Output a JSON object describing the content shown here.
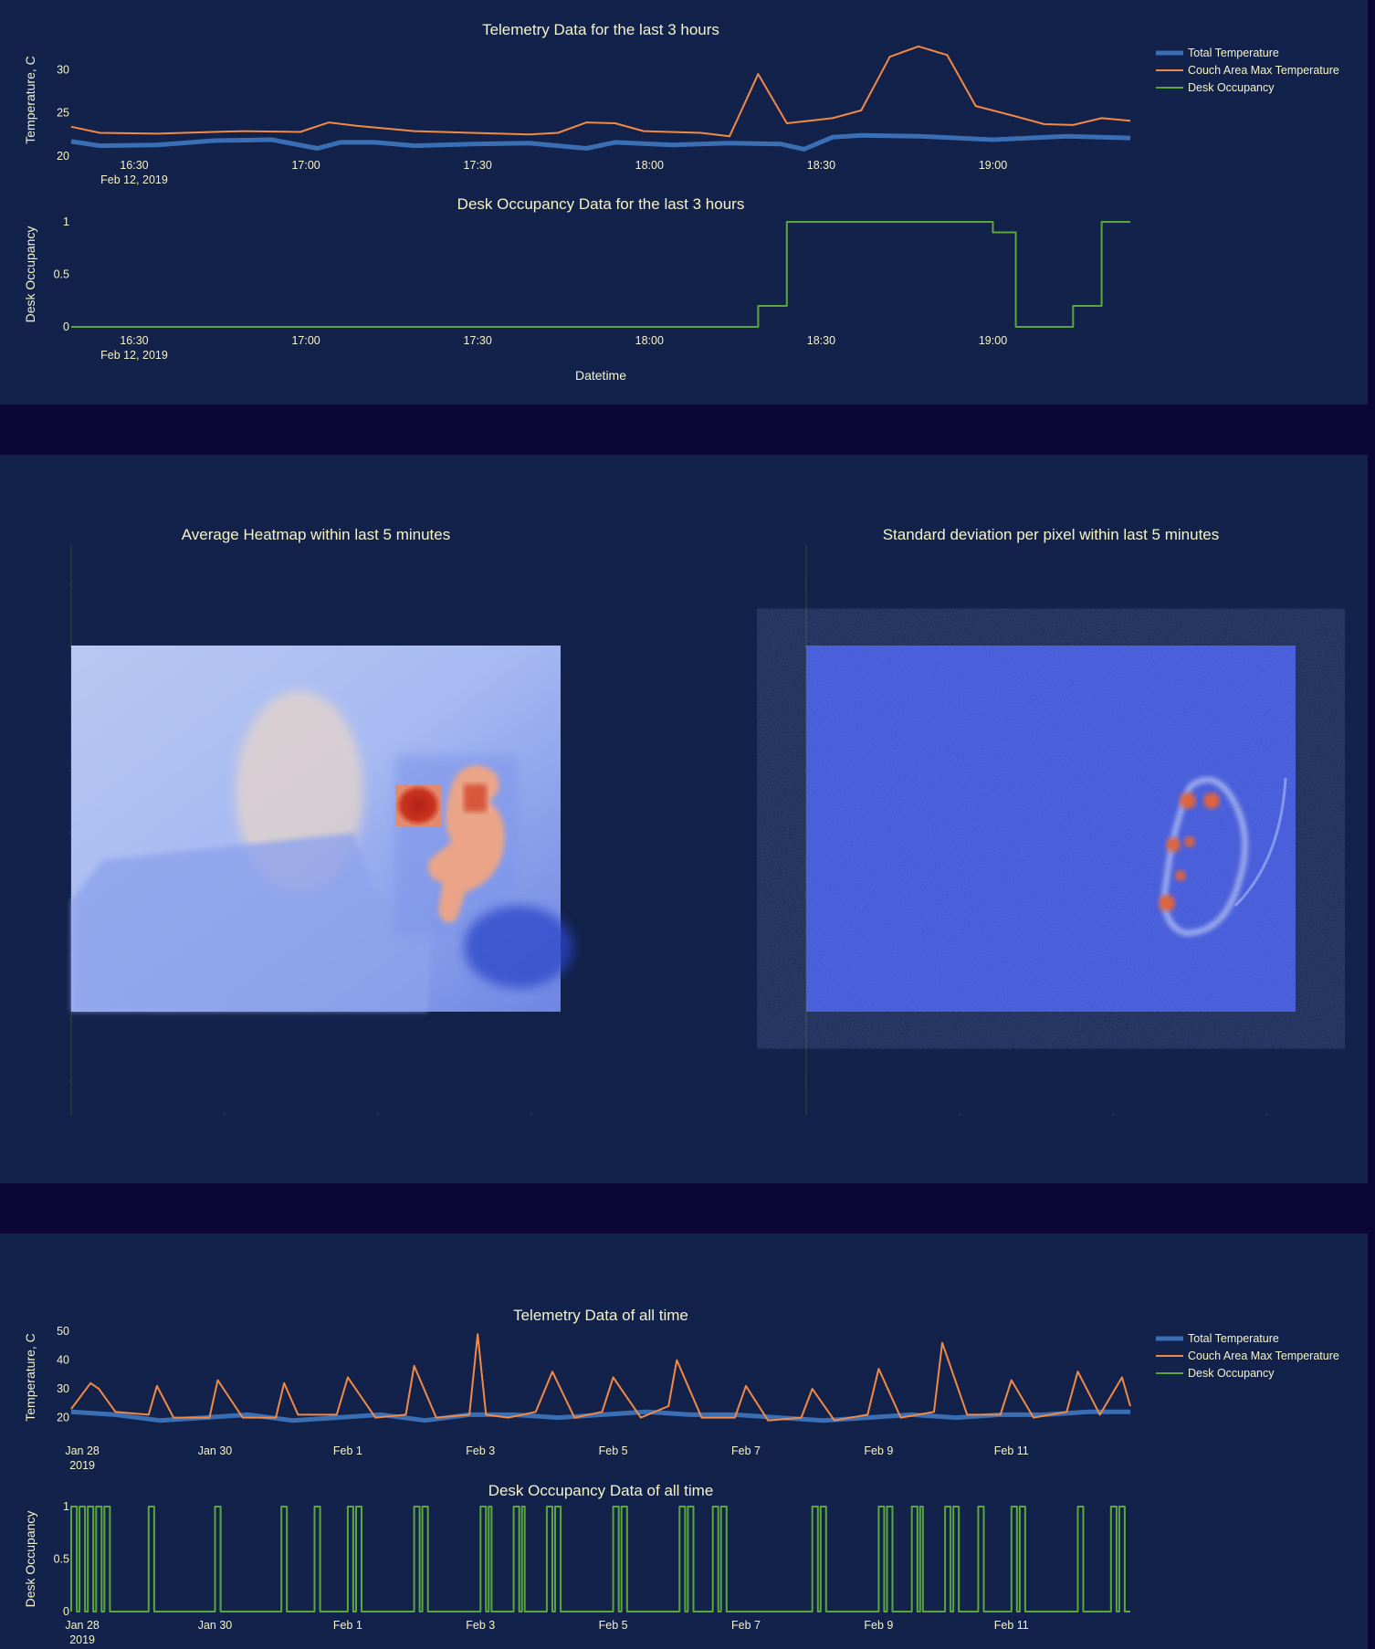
{
  "colors": {
    "page_background": "#0a0636",
    "panel_background": "#13224a",
    "text": "#f5f3c8",
    "total_temperature": "#3a6fb5",
    "couch_max_temperature": "#f28a45",
    "desk_occupancy": "#5aa83c"
  },
  "legend": {
    "items": [
      "Total Temperature",
      "Couch Area Max Temperature",
      "Desk Occupancy"
    ]
  },
  "chart_data": [
    {
      "id": "telemetry_3h",
      "type": "line",
      "title": "Telemetry Data for the last 3 hours",
      "ylabel": "Temperature, C",
      "xlabel": "",
      "x_range": [
        "16:19",
        "19:24"
      ],
      "x_ticks": [
        {
          "t": "16:30",
          "label": "16:30",
          "sub": "Feb 12, 2019"
        },
        {
          "t": "17:00",
          "label": "17:00",
          "sub": ""
        },
        {
          "t": "17:30",
          "label": "17:30",
          "sub": ""
        },
        {
          "t": "18:00",
          "label": "18:00",
          "sub": ""
        },
        {
          "t": "18:30",
          "label": "18:30",
          "sub": ""
        },
        {
          "t": "19:00",
          "label": "19:00",
          "sub": ""
        }
      ],
      "y_ticks": [
        20,
        25,
        30
      ],
      "ylim": [
        20,
        33
      ],
      "series": [
        {
          "name": "Total Temperature",
          "x": [
            "16:19",
            "16:24",
            "16:34",
            "16:44",
            "16:54",
            "17:02",
            "17:06",
            "17:12",
            "17:19",
            "17:29",
            "17:39",
            "17:49",
            "17:54",
            "18:04",
            "18:14",
            "18:23",
            "18:27",
            "18:32",
            "18:37",
            "18:47",
            "19:00",
            "19:13",
            "19:24"
          ],
          "y": [
            21.7,
            21.2,
            21.3,
            21.8,
            21.9,
            20.9,
            21.6,
            21.6,
            21.2,
            21.4,
            21.5,
            20.9,
            21.6,
            21.3,
            21.5,
            21.4,
            20.8,
            22.2,
            22.4,
            22.3,
            21.9,
            22.3,
            22.1
          ]
        },
        {
          "name": "Couch Area Max Temperature",
          "x": [
            "16:19",
            "16:24",
            "16:34",
            "16:49",
            "16:59",
            "17:04",
            "17:09",
            "17:19",
            "17:29",
            "17:39",
            "17:44",
            "17:49",
            "17:54",
            "17:59",
            "18:09",
            "18:14",
            "18:19",
            "18:24",
            "18:32",
            "18:37",
            "18:42",
            "18:47",
            "18:52",
            "18:57",
            "19:04",
            "19:09",
            "19:14",
            "19:19",
            "19:24"
          ],
          "y": [
            23.4,
            22.7,
            22.6,
            22.9,
            22.8,
            23.9,
            23.5,
            22.9,
            22.7,
            22.5,
            22.7,
            23.9,
            23.8,
            22.9,
            22.7,
            22.3,
            29.5,
            23.8,
            24.4,
            25.3,
            31.5,
            32.7,
            31.7,
            25.8,
            24.6,
            23.7,
            23.6,
            24.4,
            24.1
          ]
        }
      ]
    },
    {
      "id": "occupancy_3h",
      "type": "line",
      "title": "Desk Occupancy Data for the last 3 hours",
      "ylabel": "Desk Occupancy",
      "xlabel": "Datetime",
      "x_range": [
        "16:19",
        "19:24"
      ],
      "x_ticks": [
        {
          "t": "16:30",
          "label": "16:30",
          "sub": "Feb 12, 2019"
        },
        {
          "t": "17:00",
          "label": "17:00",
          "sub": ""
        },
        {
          "t": "17:30",
          "label": "17:30",
          "sub": ""
        },
        {
          "t": "18:00",
          "label": "18:00",
          "sub": ""
        },
        {
          "t": "18:30",
          "label": "18:30",
          "sub": ""
        },
        {
          "t": "19:00",
          "label": "19:00",
          "sub": ""
        }
      ],
      "y_ticks": [
        0,
        0.5,
        1
      ],
      "ylim": [
        0,
        1
      ],
      "series": [
        {
          "name": "Desk Occupancy",
          "step": true,
          "x": [
            "16:19",
            "18:19",
            "18:24",
            "19:00",
            "19:04",
            "19:14",
            "19:19",
            "19:24"
          ],
          "y": [
            0,
            0.2,
            1,
            0.9,
            0,
            0.2,
            1,
            1
          ]
        }
      ]
    },
    {
      "id": "avg_heatmap",
      "type": "heatmap",
      "title": "Average Heatmap within last 5 minutes",
      "colorscale": "coolwarm"
    },
    {
      "id": "std_heatmap",
      "type": "heatmap",
      "title": "Standard deviation per pixel within last 5 minutes",
      "colorscale": "coolwarm"
    },
    {
      "id": "telemetry_all",
      "type": "line",
      "title": "Telemetry Data of all time",
      "ylabel": "Temperature, C",
      "xlabel": "",
      "x_range": [
        "2019-01-27T20:00",
        "2019-02-12T19:00"
      ],
      "x_ticks": [
        {
          "t": "2019-01-28",
          "label": "Jan 28",
          "sub": "2019"
        },
        {
          "t": "2019-01-30",
          "label": "Jan 30",
          "sub": ""
        },
        {
          "t": "2019-02-01",
          "label": "Feb 1",
          "sub": ""
        },
        {
          "t": "2019-02-03",
          "label": "Feb 3",
          "sub": ""
        },
        {
          "t": "2019-02-05",
          "label": "Feb 5",
          "sub": ""
        },
        {
          "t": "2019-02-07",
          "label": "Feb 7",
          "sub": ""
        },
        {
          "t": "2019-02-09",
          "label": "Feb 9",
          "sub": ""
        },
        {
          "t": "2019-02-11",
          "label": "Feb 11",
          "sub": ""
        }
      ],
      "y_ticks": [
        20,
        30,
        40,
        50
      ],
      "ylim": [
        17,
        51
      ],
      "series": [
        {
          "name": "Total Temperature",
          "x": [
            "2019-01-27T20:00",
            "2019-01-28T12:00",
            "2019-01-29T04:00",
            "2019-01-29T20:00",
            "2019-01-30T12:00",
            "2019-01-31T04:00",
            "2019-01-31T20:00",
            "2019-02-01T12:00",
            "2019-02-02T04:00",
            "2019-02-02T20:00",
            "2019-02-03T12:00",
            "2019-02-04T04:00",
            "2019-02-04T20:00",
            "2019-02-05T12:00",
            "2019-02-06T04:00",
            "2019-02-06T20:00",
            "2019-02-07T12:00",
            "2019-02-08T04:00",
            "2019-02-08T20:00",
            "2019-02-09T12:00",
            "2019-02-10T04:00",
            "2019-02-10T20:00",
            "2019-02-11T12:00",
            "2019-02-12T04:00",
            "2019-02-12T19:00"
          ],
          "y": [
            22,
            21,
            19,
            20,
            21,
            19,
            20,
            21,
            19,
            21,
            21,
            20,
            21,
            22,
            21,
            21,
            20,
            19,
            20,
            21,
            20,
            21,
            21,
            22,
            22
          ]
        },
        {
          "name": "Couch Area Max Temperature",
          "x": [
            "2019-01-27T20:00",
            "2019-01-28T03:00",
            "2019-01-28T06:00",
            "2019-01-28T12:00",
            "2019-01-29T00:00",
            "2019-01-29T03:00",
            "2019-01-29T09:00",
            "2019-01-29T22:00",
            "2019-01-30T01:00",
            "2019-01-30T10:00",
            "2019-01-30T22:00",
            "2019-01-31T01:00",
            "2019-01-31T06:00",
            "2019-01-31T20:00",
            "2019-02-01T00:00",
            "2019-02-01T10:00",
            "2019-02-01T21:00",
            "2019-02-02T00:00",
            "2019-02-02T08:00",
            "2019-02-02T20:00",
            "2019-02-02T23:00",
            "2019-02-03T02:00",
            "2019-02-03T10:00",
            "2019-02-03T20:00",
            "2019-02-04T02:00",
            "2019-02-04T10:00",
            "2019-02-04T20:00",
            "2019-02-05T00:00",
            "2019-02-05T10:00",
            "2019-02-05T20:00",
            "2019-02-05T23:00",
            "2019-02-06T08:00",
            "2019-02-06T20:00",
            "2019-02-07T00:00",
            "2019-02-07T08:00",
            "2019-02-07T20:00",
            "2019-02-08T00:00",
            "2019-02-08T08:00",
            "2019-02-08T20:00",
            "2019-02-09T00:00",
            "2019-02-09T08:00",
            "2019-02-09T20:00",
            "2019-02-09T23:00",
            "2019-02-10T08:00",
            "2019-02-10T20:00",
            "2019-02-11T00:00",
            "2019-02-11T08:00",
            "2019-02-11T20:00",
            "2019-02-12T00:00",
            "2019-02-12T08:00",
            "2019-02-12T16:00",
            "2019-02-12T19:00"
          ],
          "y": [
            23,
            32,
            30,
            22,
            21,
            31,
            20,
            20,
            33,
            20,
            20,
            32,
            21,
            21,
            34,
            20,
            21,
            38,
            20,
            21,
            49,
            21,
            20,
            22,
            36,
            20,
            22,
            34,
            20,
            24,
            40,
            20,
            20,
            31,
            19,
            20,
            30,
            19,
            21,
            37,
            20,
            22,
            46,
            21,
            21,
            33,
            20,
            22,
            36,
            21,
            34,
            24
          ]
        }
      ]
    },
    {
      "id": "occupancy_all",
      "type": "line",
      "title": "Desk Occupancy Data of all time",
      "ylabel": "Desk Occupancy",
      "xlabel": "",
      "x_range": [
        "2019-01-27T20:00",
        "2019-02-12T19:00"
      ],
      "x_ticks": [
        {
          "t": "2019-01-28",
          "label": "Jan 28",
          "sub": "2019"
        },
        {
          "t": "2019-01-30",
          "label": "Jan 30",
          "sub": ""
        },
        {
          "t": "2019-02-01",
          "label": "Feb 1",
          "sub": ""
        },
        {
          "t": "2019-02-03",
          "label": "Feb 3",
          "sub": ""
        },
        {
          "t": "2019-02-05",
          "label": "Feb 5",
          "sub": ""
        },
        {
          "t": "2019-02-07",
          "label": "Feb 7",
          "sub": ""
        },
        {
          "t": "2019-02-09",
          "label": "Feb 9",
          "sub": ""
        },
        {
          "t": "2019-02-11",
          "label": "Feb 11",
          "sub": ""
        }
      ],
      "y_ticks": [
        0,
        0.5,
        1
      ],
      "ylim": [
        0,
        1
      ],
      "series": [
        {
          "name": "Desk Occupancy",
          "step": true,
          "occupied_intervals": [
            [
              "2019-01-27T20:00",
              "2019-01-28T10:00"
            ],
            [
              "2019-01-29T00:00",
              "2019-01-29T02:00"
            ],
            [
              "2019-01-30T00:00",
              "2019-01-30T02:00"
            ],
            [
              "2019-01-31T00:00",
              "2019-01-31T03:00"
            ],
            [
              "2019-01-31T12:00",
              "2019-01-31T15:00"
            ],
            [
              "2019-02-01T00:00",
              "2019-02-01T06:00"
            ],
            [
              "2019-02-02T00:00",
              "2019-02-02T05:00"
            ],
            [
              "2019-02-03T00:00",
              "2019-02-03T04:00"
            ],
            [
              "2019-02-03T12:00",
              "2019-02-03T16:00"
            ],
            [
              "2019-02-04T00:00",
              "2019-02-04T05:00"
            ],
            [
              "2019-02-05T00:00",
              "2019-02-05T05:00"
            ],
            [
              "2019-02-06T00:00",
              "2019-02-06T05:00"
            ],
            [
              "2019-02-06T12:00",
              "2019-02-06T18:00"
            ],
            [
              "2019-02-08T00:00",
              "2019-02-08T05:00"
            ],
            [
              "2019-02-09T00:00",
              "2019-02-09T05:00"
            ],
            [
              "2019-02-09T12:00",
              "2019-02-09T16:00"
            ],
            [
              "2019-02-10T00:00",
              "2019-02-10T05:00"
            ],
            [
              "2019-02-10T12:00",
              "2019-02-10T15:00"
            ],
            [
              "2019-02-11T00:00",
              "2019-02-11T05:00"
            ],
            [
              "2019-02-12T00:00",
              "2019-02-12T03:00"
            ],
            [
              "2019-02-12T12:00",
              "2019-02-12T18:00"
            ]
          ]
        }
      ]
    }
  ]
}
